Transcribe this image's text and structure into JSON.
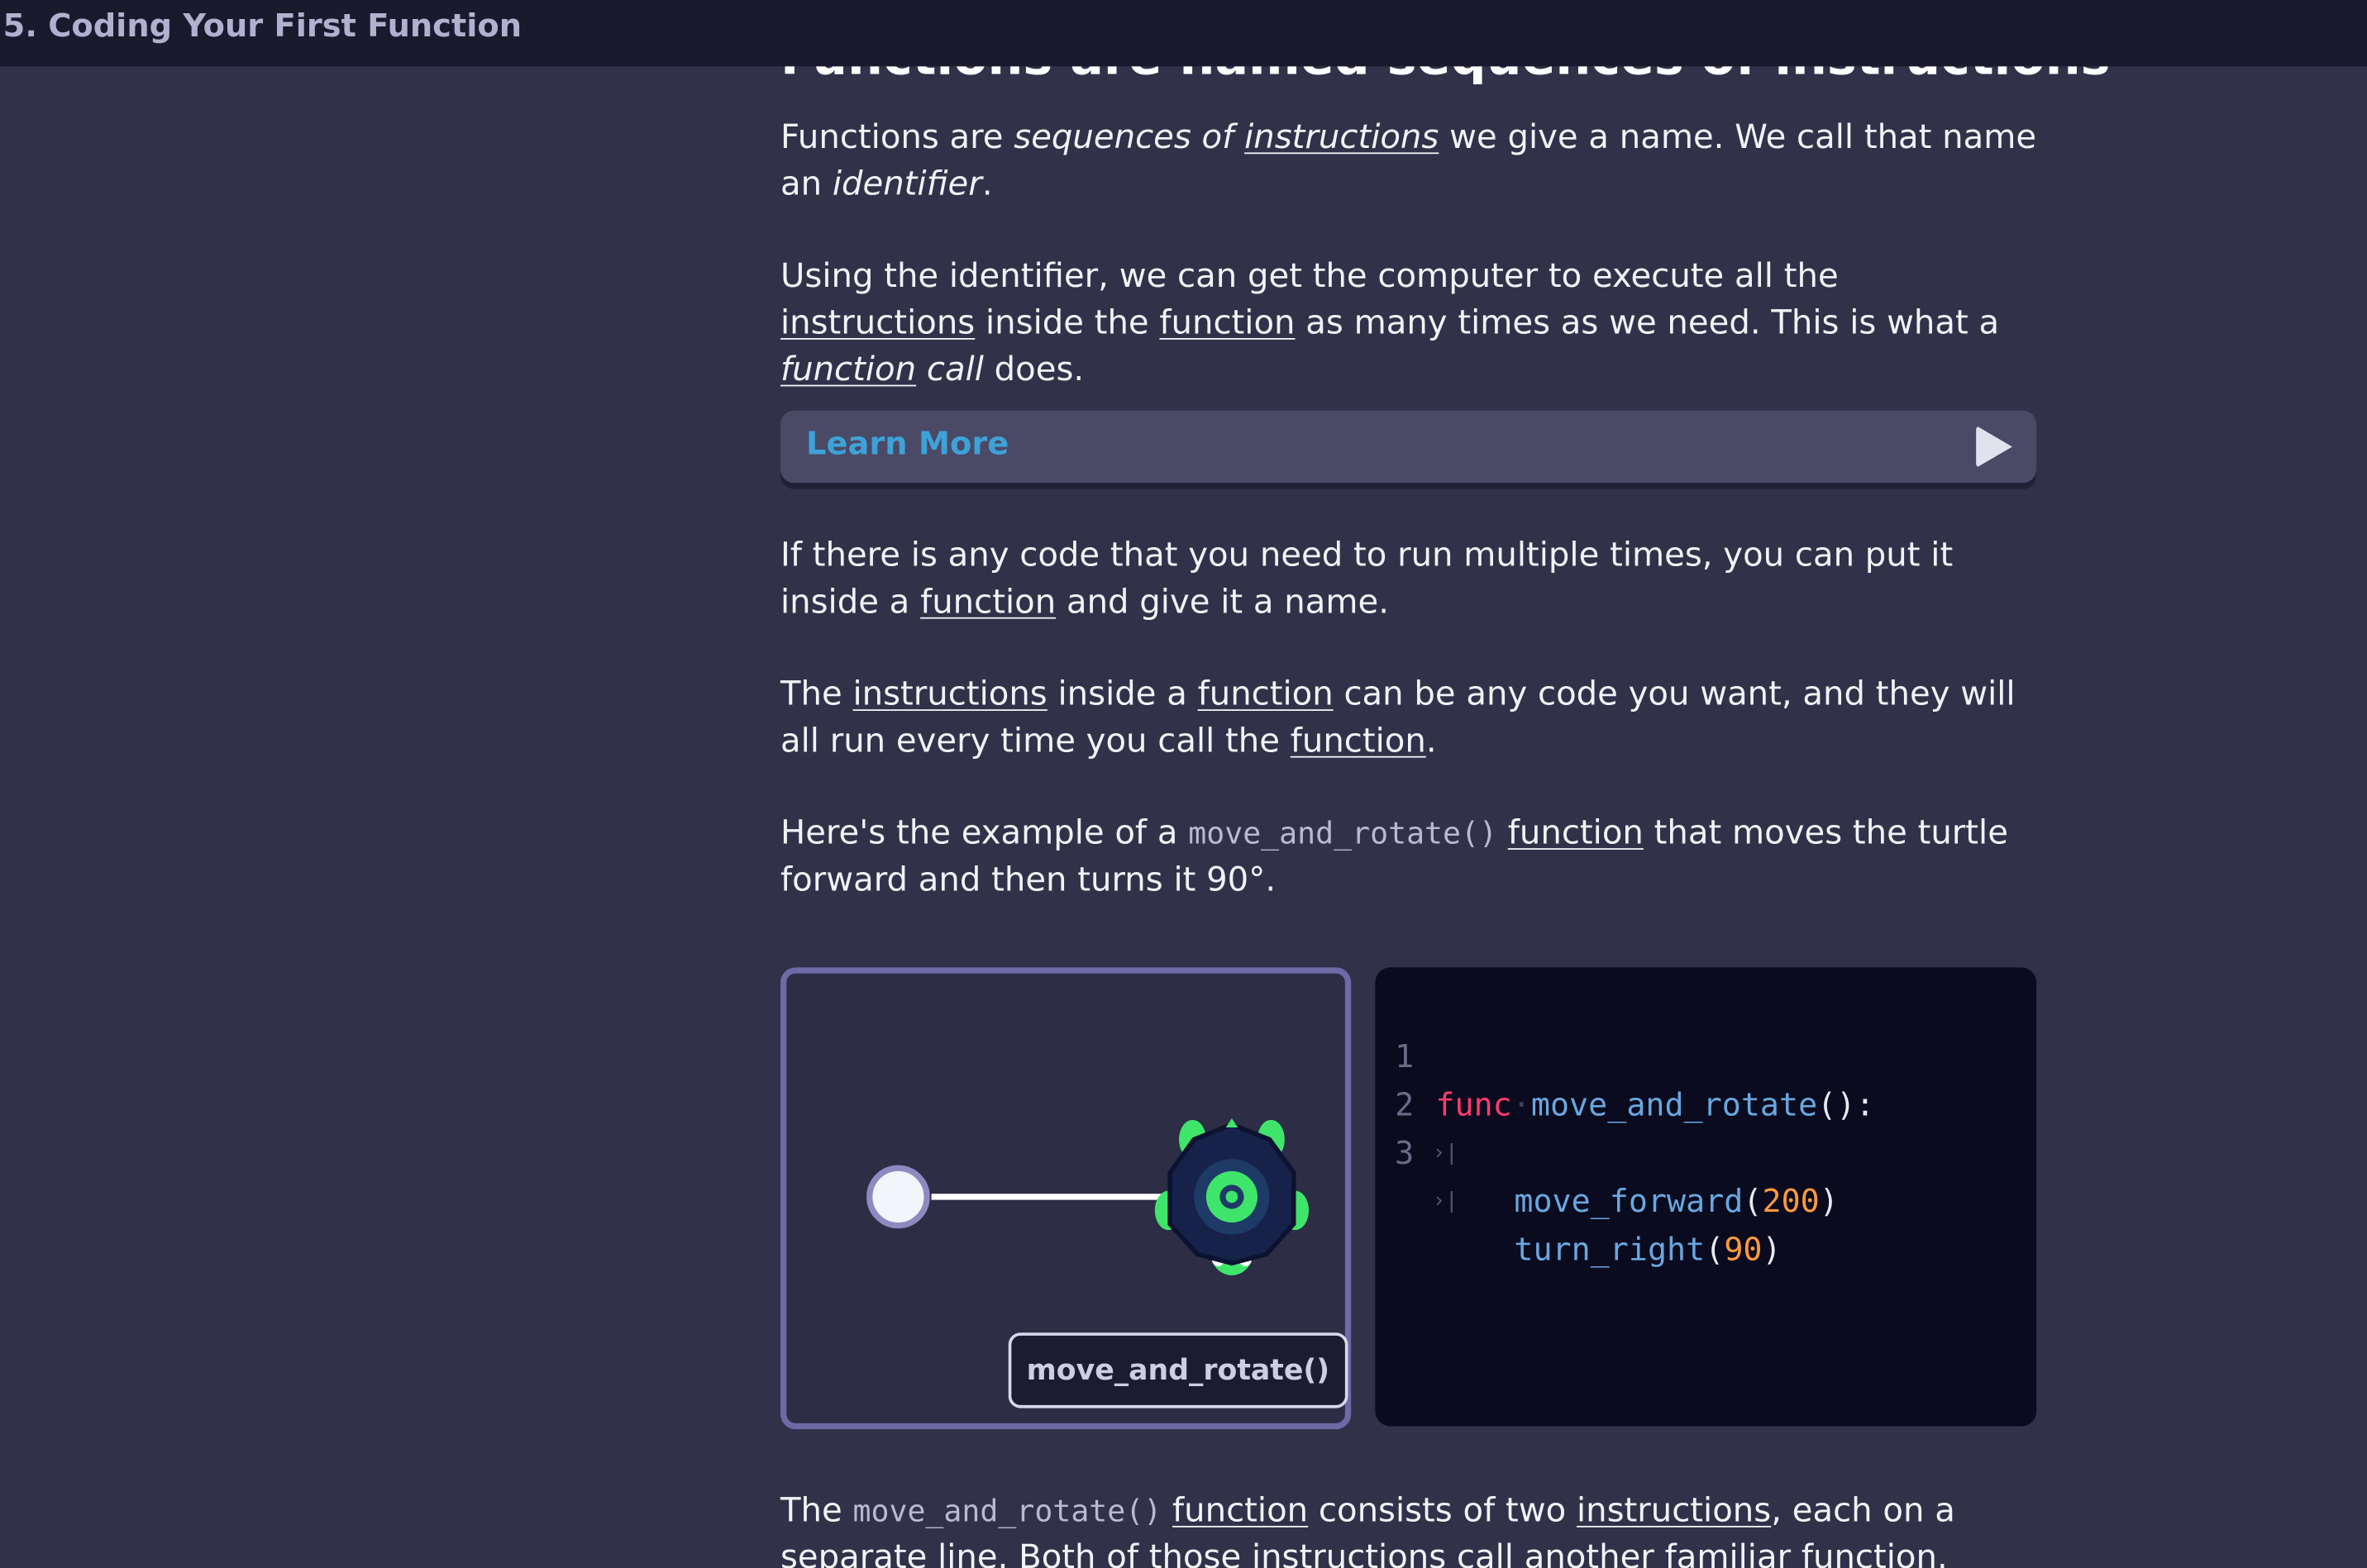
{
  "header": {
    "lesson_title": "5. Coding Your First Function"
  },
  "content": {
    "section_heading": "Functions are named sequences of instructions",
    "p1": {
      "a": "Functions are ",
      "b": "sequences of",
      "c": "instructions",
      "d": " we give a name. We call that name an ",
      "e": "identifier",
      "f": "."
    },
    "p2": {
      "a": "Using the identifier, we can get the computer to execute all the ",
      "b": "instructions",
      "c": " inside the ",
      "d": "function",
      "e": " as many times as we need. This is what a ",
      "f": "function",
      "g": " call",
      "h": " does."
    },
    "learn_more": {
      "label": "Learn More",
      "icon": "play-icon"
    },
    "p3": {
      "a": "If there is any code that you need to run multiple times, you can put it inside a ",
      "b": "function",
      "c": " and give it a name."
    },
    "p4": {
      "a": "The ",
      "b": "instructions",
      "c": " inside a ",
      "d": "function",
      "e": " can be any code you want, and they will all run every time you call the ",
      "f": "function",
      "g": "."
    },
    "p5": {
      "a": "Here's the example of a ",
      "b": "move_and_rotate()",
      "c": " ",
      "d": "function",
      "e": " that moves the turtle forward and then turns it 90°."
    },
    "demo": {
      "run_button": "move_and_rotate()",
      "turtle_icon": "turtle-icon"
    },
    "code": {
      "lines": [
        {
          "num": "1",
          "kw": "func",
          "name": "move_and_rotate",
          "open": "()",
          "close": ":"
        },
        {
          "num": "2",
          "name": "move_forward",
          "open": "(",
          "arg": "200",
          "close": ")"
        },
        {
          "num": "3",
          "name": "turn_right",
          "open": "(",
          "arg": "90",
          "close": ")"
        }
      ],
      "tab_glyph": "›|"
    },
    "p6": {
      "a": "The ",
      "b": "move_and_rotate()",
      "c": " ",
      "d": "function",
      "e": " consists of two ",
      "f": "instructions",
      "g": ", each on a separate line. Both of those instructions call another familiar function."
    }
  },
  "colors": {
    "background": "#313149",
    "topbar": "#1a1a2e",
    "accent_link": "#3ea2d8",
    "code_bg": "#0a0b1e",
    "keyword": "#ff3b6c",
    "function_name": "#68a7e0",
    "number": "#ff9a3c",
    "turtle_green": "#3ee56a"
  }
}
